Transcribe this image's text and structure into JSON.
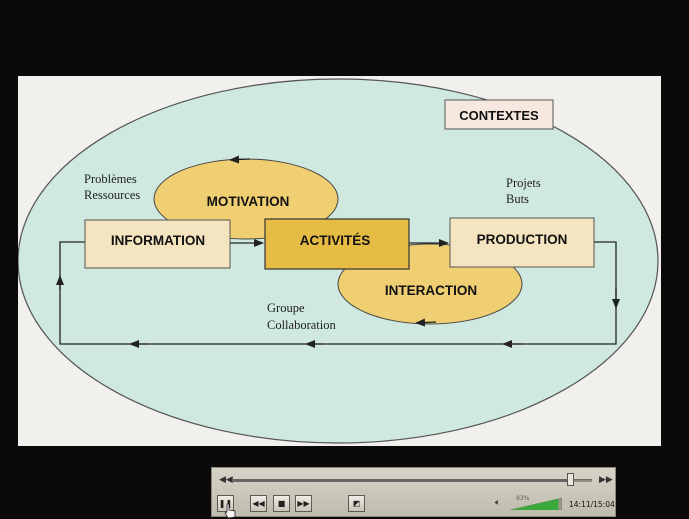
{
  "slide": {
    "context_label": "CONTEXTES",
    "boxes": {
      "information": "INFORMATION",
      "activities": "ACTIVITÉS",
      "production": "PRODUCTION"
    },
    "lobes": {
      "motivation": "MOTIVATION",
      "interaction": "INTERACTION"
    },
    "notes": {
      "left_line1": "Problèmes",
      "left_line2": "Ressources",
      "right_line1": "Projets",
      "right_line2": "Buts",
      "bottom_line1": "Groupe",
      "bottom_line2": "Collaboration"
    },
    "colors": {
      "ellipse_fill": "#cfe9e0",
      "box_fill": "#f5e4c0",
      "activities_fill": "#e6bc45",
      "lobe_fill": "#f0cf72",
      "line": "#222222"
    }
  },
  "player": {
    "icons": {
      "seek_start": "skip-back-icon",
      "seek_end": "skip-forward-icon",
      "pause": "pause-icon",
      "previous": "previous-icon",
      "stop": "stop-icon",
      "next": "next-icon",
      "fullscreen": "fullscreen-icon",
      "volume": "speaker-icon"
    },
    "progress_fraction": 0.94,
    "volume_label": "93%",
    "volume_fraction": 0.93,
    "time": "14:11/15:04"
  }
}
